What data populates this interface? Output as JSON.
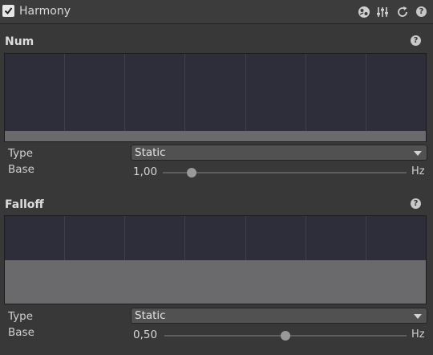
{
  "header": {
    "title": "Harmony",
    "enabled": true,
    "icons": [
      "preset-icon",
      "settings-sliders-icon",
      "reset-icon",
      "help-icon"
    ]
  },
  "sections": [
    {
      "title": "Num",
      "type_label": "Type",
      "type_value": "Static",
      "base_label": "Base",
      "base_value": "1,00",
      "unit": "Hz",
      "slider_fraction": 0.12,
      "curve_fill_fraction": 0.12
    },
    {
      "title": "Falloff",
      "type_label": "Type",
      "type_value": "Static",
      "base_label": "Base",
      "base_value": "0,50",
      "unit": "Hz",
      "slider_fraction": 0.5,
      "curve_fill_fraction": 0.5
    }
  ],
  "colors": {
    "background": "#383838",
    "curve_bg": "#2d2e3a",
    "curve_fill": "#6a6a6d"
  }
}
